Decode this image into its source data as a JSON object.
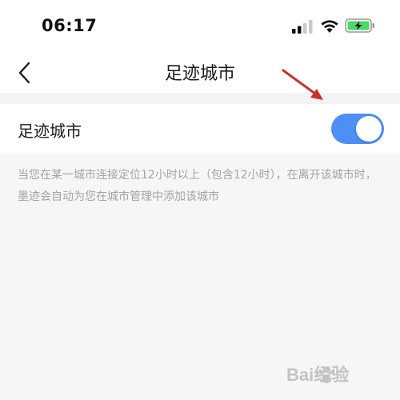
{
  "status_bar": {
    "time": "06:17",
    "signal_icon": "cellular-signal-icon",
    "wifi_icon": "wifi-icon",
    "battery_icon": "battery-charging-icon",
    "battery_color": "#4cd964"
  },
  "nav": {
    "back_icon": "chevron-left-icon",
    "title": "足迹城市"
  },
  "settings": {
    "row_label": "足迹城市",
    "toggle_on": true,
    "toggle_color": "#4d8ff7",
    "description": "当您在某一城市连接定位12小时以上（包含12小时），在离开该城市时，墨迹会自动为您在城市管理中添加该城市"
  },
  "annotation": {
    "arrow_icon": "red-arrow-icon",
    "arrow_color": "#c8302c"
  },
  "watermark": {
    "text": "Bai经验",
    "icon": "baidu-paw-logo"
  }
}
